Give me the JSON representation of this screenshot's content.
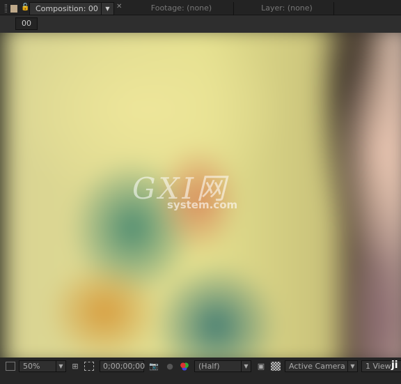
{
  "tabs": {
    "composition": "Composition: 00",
    "footage": "Footage: (none)",
    "layer": "Layer: (none)"
  },
  "comp_name": "00",
  "watermark": {
    "logo": "GXI网",
    "site": "system.com",
    "corner": "ji"
  },
  "footer": {
    "zoom": "50%",
    "timecode": "0;00;00;00",
    "resolution": "(Half)",
    "camera": "Active Camera",
    "views": "1 View"
  }
}
